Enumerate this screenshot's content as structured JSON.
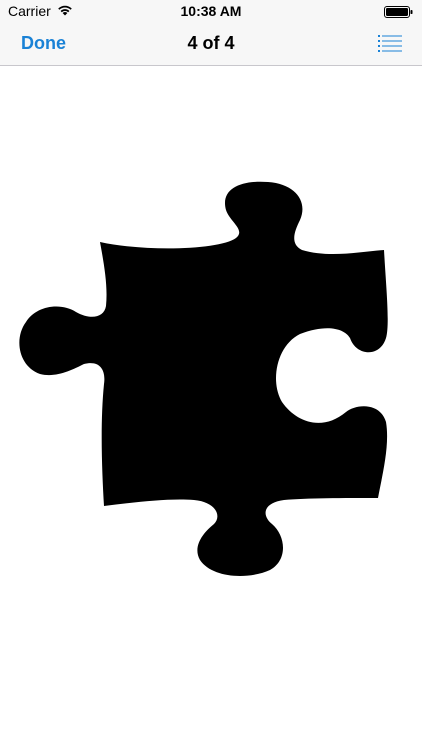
{
  "status_bar": {
    "carrier": "Carrier",
    "time": "10:38 AM",
    "icons": [
      "wifi-icon",
      "battery-icon"
    ]
  },
  "nav": {
    "done_label": "Done",
    "title": "4 of 4",
    "list_icon": "list-icon"
  },
  "content": {
    "image": "puzzle-piece-icon"
  },
  "colors": {
    "accent": "#1a82d6",
    "bar_background": "#f7f7f7",
    "piece": "#000000"
  }
}
